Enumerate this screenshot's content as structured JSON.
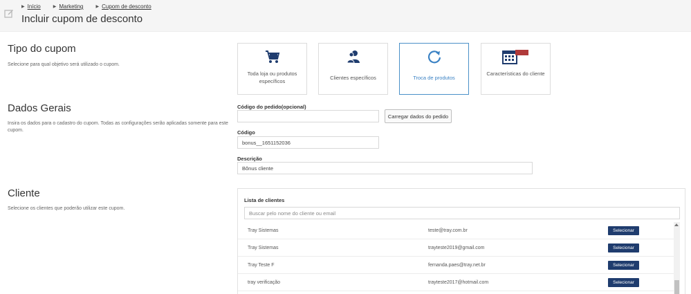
{
  "header": {
    "breadcrumb": [
      "Início",
      "Marketing",
      "Cupom de desconto"
    ],
    "title": "Incluir cupom de desconto"
  },
  "tipo": {
    "title": "Tipo do cupom",
    "description": "Selecione para qual objetivo será utilizado o cupom.",
    "cards": [
      {
        "label": "Toda loja ou produtos específicos",
        "icon": "cart-icon"
      },
      {
        "label": "Clientes específicos",
        "icon": "users-icon"
      },
      {
        "label": "Troca de produtos",
        "icon": "refresh-icon",
        "selected": true
      },
      {
        "label": "Características do cliente",
        "icon": "calendar-icon"
      }
    ]
  },
  "dados": {
    "title": "Dados Gerais",
    "description": "Insira os dados para o cadastro do cupom. Todas as configurações serão aplicadas somente para este cupom.",
    "order_code_label": "Código do pedido(opcional)",
    "order_code_value": "",
    "load_button": "Carregar dados do pedido",
    "code_label": "Código",
    "code_value": "bonus__1651152036",
    "desc_label": "Descrição",
    "desc_value": "Bônus cliente"
  },
  "cliente": {
    "title": "Cliente",
    "description": "Selecione os clientes que poderão utilizar este cupom.",
    "list_title": "Lista de clientes",
    "search_placeholder": "Buscar pelo nome do cliente ou email",
    "select_label": "Selecionar",
    "rows": [
      {
        "name": "Tray Sistemas",
        "email": "teste@tray.com.br"
      },
      {
        "name": "Tray Sistemas",
        "email": "trayteste2019@gmail.com"
      },
      {
        "name": "Tray Teste F",
        "email": "fernanda.paes@tray.net.br"
      },
      {
        "name": "tray verificação",
        "email": "trayteste2017@hotmail.com"
      }
    ]
  },
  "colors": {
    "accent": "#3b82c4",
    "button_dark": "#1f3c6e",
    "icon_dark": "#1f3c6e"
  }
}
